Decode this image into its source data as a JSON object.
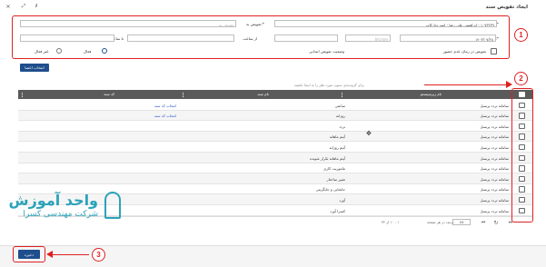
{
  "dialog": {
    "title": "ایجاد تفویض سند",
    "info_icon": "i",
    "expand_icon": "⤢",
    "close_icon": "×"
  },
  "form": {
    "from_delegate_label": "تفویض از:*",
    "from_delegate_value": "۱۰۷۳۲۳۹ - ابراهیمی علی رضا - امور تدارکات",
    "to_delegate_label": "تفویض به:*",
    "to_delegate_placeholder": "تفویض به",
    "from_date_label": "از تاریخ:*",
    "from_date_value": "۱۴۰۳/۰۷/۲۸",
    "from_date_hint": "hh:mm",
    "to_date_label": "تا تاریخ:*",
    "from_time_label": "از ساعت",
    "to_time_label": "تا ساعت",
    "absence_checkbox_label": "تفویض در زمان عدم حضور",
    "initial_status_label": "وضعیت تفویض ابتدایی",
    "active_label": "فعال",
    "inactive_label": "غیر فعال",
    "select_members_button": "انتخاب اعضا"
  },
  "table": {
    "hint": "برای گروه‌بندی ستون مورد نظر را به اینجا بکشید",
    "headers": {
      "subsystem": "نام زیرسیستم",
      "document_name": "نام سند",
      "document_code": "کد سند"
    },
    "rows": [
      {
        "subsystem": "سامانه تردد پرسنل",
        "document_name": "ساعتی",
        "document_code": "انتخاب کد سند"
      },
      {
        "subsystem": "سامانه تردد پرسنل",
        "document_name": "روزانه",
        "document_code": "انتخاب کد سند"
      },
      {
        "subsystem": "سامانه تردد پرسنل",
        "document_name": "تردد",
        "document_code": ""
      },
      {
        "subsystem": "سامانه تردد پرسنل",
        "document_name": "آیتم ماهانه",
        "document_code": ""
      },
      {
        "subsystem": "سامانه تردد پرسنل",
        "document_name": "آیتم روزانه",
        "document_code": ""
      },
      {
        "subsystem": "سامانه تردد پرسنل",
        "document_name": "آیتم ماهانه تکرار شونده",
        "document_code": ""
      },
      {
        "subsystem": "سامانه تردد پرسنل",
        "document_name": "ماموریت کاری",
        "document_code": ""
      },
      {
        "subsystem": "سامانه تردد پرسنل",
        "document_name": "تغییر ساختار",
        "document_code": ""
      },
      {
        "subsystem": "سامانه تردد پرسنل",
        "document_name": "جابجایی و جایگزینی",
        "document_code": ""
      },
      {
        "subsystem": "سامانه تردد پرسنل",
        "document_name": "آورد",
        "document_code": ""
      },
      {
        "subsystem": "سامانه تردد پرسنل",
        "document_name": "کسرا آورد",
        "document_code": ""
      }
    ],
    "pagination": {
      "page_size": "10",
      "page_size_label": "ردیف در هر صفحه",
      "page_info": "۱ - ۱۰ از ۳۴"
    }
  },
  "footer": {
    "save_button": "ذخیره"
  },
  "watermark": {
    "title": "واحد آموزش",
    "subtitle": "شرکت مهندسی کسرا"
  },
  "annotations": [
    "1",
    "2",
    "3"
  ],
  "colors": {
    "accent": "#1f4e8c",
    "annotation": "#e02020",
    "header_bg": "#5a5a5a",
    "watermark": "#2ba3b9"
  }
}
